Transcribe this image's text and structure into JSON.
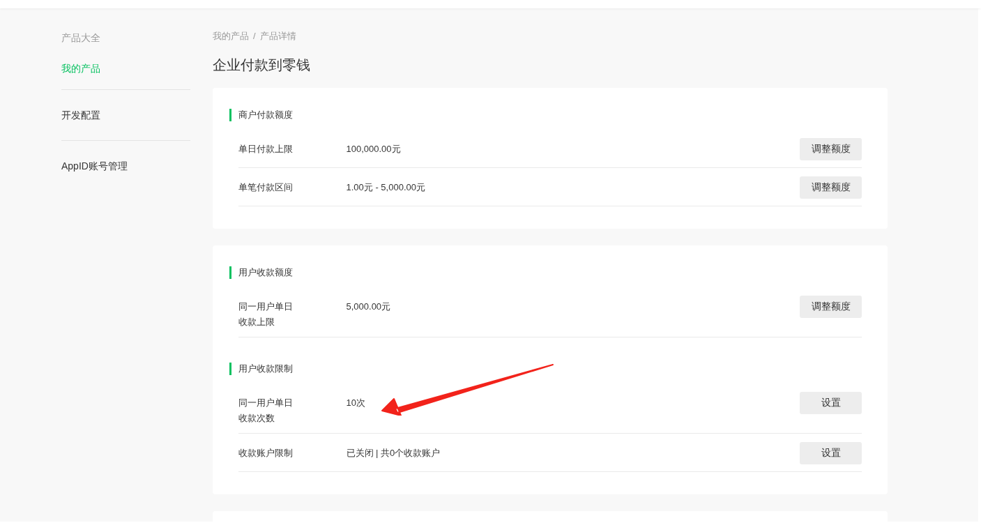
{
  "sidebar": {
    "groups": [
      {
        "title": "产品大全",
        "items": [
          {
            "label": "我的产品",
            "selected": true
          }
        ]
      },
      {
        "items": [
          {
            "label": "开发配置",
            "selected": false
          }
        ]
      },
      {
        "items": [
          {
            "label": "AppID账号管理",
            "selected": false
          }
        ]
      }
    ]
  },
  "breadcrumb": {
    "items": [
      "我的产品",
      "产品详情"
    ],
    "separator": "/"
  },
  "page_title": "企业付款到零钱",
  "cards": [
    {
      "sections": [
        {
          "title": "商户付款额度",
          "rows": [
            {
              "label": "单日付款上限",
              "value": "100,000.00元",
              "button": "调整额度"
            },
            {
              "label": "单笔付款区间",
              "value": "1.00元 - 5,000.00元",
              "button": "调整额度"
            }
          ]
        }
      ]
    },
    {
      "sections": [
        {
          "title": "用户收款额度",
          "rows": [
            {
              "label": "同一用户单日收款上限",
              "value": "5,000.00元",
              "button": "调整额度"
            }
          ]
        },
        {
          "title": "用户收款限制",
          "rows": [
            {
              "label": "同一用户单日收款次数",
              "value": "10次",
              "button": "设置"
            },
            {
              "label": "收款账户限制",
              "value": "已关闭 | 共0个收款账户",
              "button": "设置"
            }
          ]
        }
      ]
    }
  ]
}
